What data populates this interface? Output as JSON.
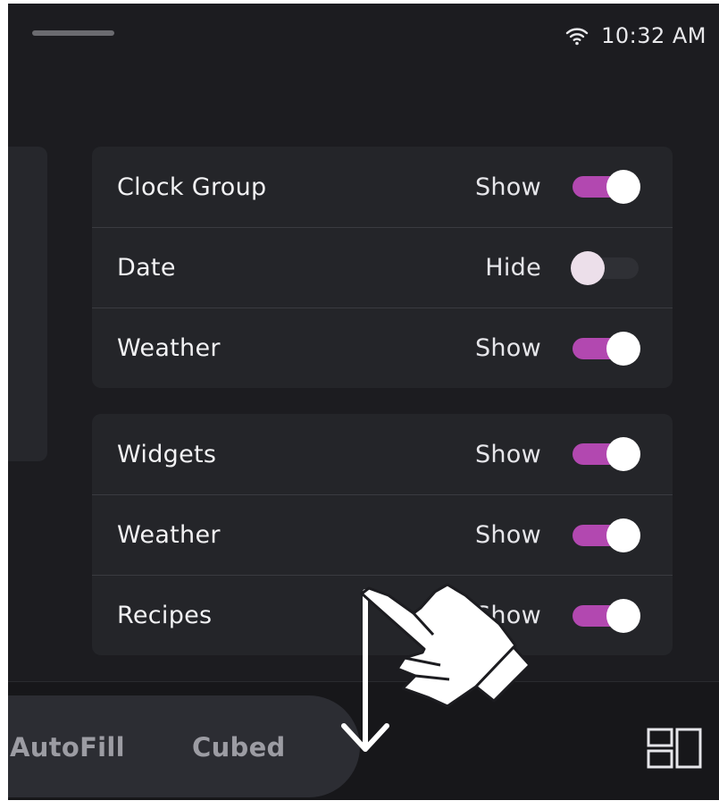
{
  "status_bar": {
    "wifi_icon": "wifi-icon",
    "time": "10:32 AM"
  },
  "settings": {
    "group_1": [
      {
        "label": "Clock Group",
        "state": "Show",
        "enabled": true
      },
      {
        "label": "Date",
        "state": "Hide",
        "enabled": false
      },
      {
        "label": "Weather",
        "state": "Show",
        "enabled": true
      }
    ],
    "group_2": [
      {
        "label": "Widgets",
        "state": "Show",
        "enabled": true
      },
      {
        "label": "Weather",
        "state": "Show",
        "enabled": true
      },
      {
        "label": "Recipes",
        "state": "Show",
        "enabled": true
      }
    ]
  },
  "bottom_bar": {
    "modes": [
      "AutoFill",
      "Cubed"
    ],
    "layout_icon": "layout-toggle-icon"
  },
  "colors": {
    "accent": "#b248b0",
    "background": "#1c1c20",
    "card": "#242529"
  },
  "gesture": {
    "icon": "swipe-down-hand-icon"
  }
}
